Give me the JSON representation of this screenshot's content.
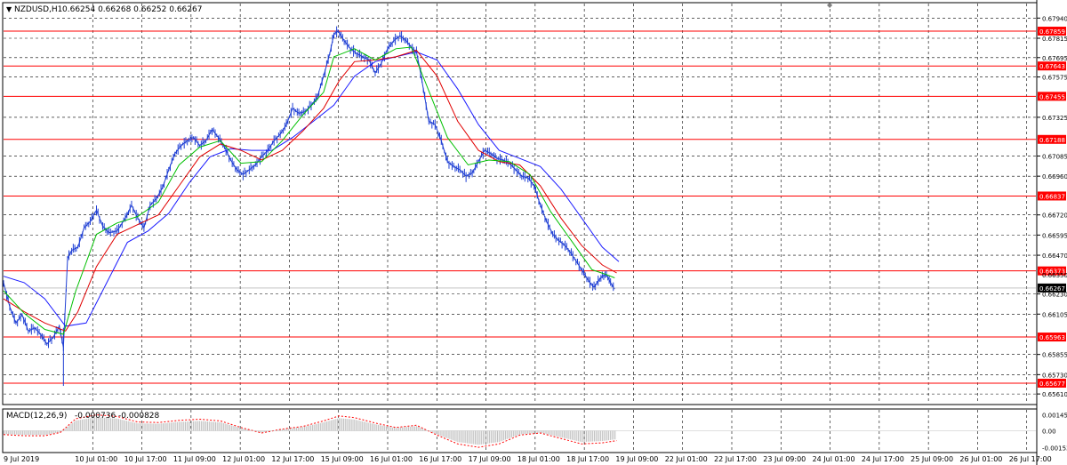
{
  "header": {
    "symbol_tf": "NZDUSD,H1",
    "ohlc": "0.66254 0.66268 0.66252 0.66267"
  },
  "macd_header": {
    "label": "MACD(12,26,9)",
    "values": "-0.000736 -0.000828"
  },
  "colors": {
    "background": "#ffffff",
    "grid": "#000000",
    "candles": "#1f3fd4",
    "ma_fast": "#00c000",
    "ma_mid": "#e00000",
    "ma_slow": "#1a1aff",
    "levels": "#ff0000",
    "macd_hist": "#c0c0c0",
    "macd_signal": "#ff0000"
  },
  "chart_data": [
    {
      "type": "line",
      "title": "NZDUSD,H1",
      "ylim": [
        0.6555,
        0.6803
      ],
      "y_ticks": [
        "0.67940",
        "0.67815",
        "0.67695",
        "0.67575",
        "0.67325",
        "0.67085",
        "0.66960",
        "0.66720",
        "0.66595",
        "0.66470",
        "0.66230",
        "0.66105",
        "0.65855",
        "0.65730",
        "0.65610"
      ],
      "x_labels": [
        "9 Jul 2019",
        "10 Jul 01:00",
        "10 Jul 17:00",
        "11 Jul 09:00",
        "12 Jul 01:00",
        "12 Jul 17:00",
        "15 Jul 09:00",
        "16 Jul 01:00",
        "16 Jul 17:00",
        "17 Jul 09:00",
        "18 Jul 01:00",
        "18 Jul 17:00",
        "19 Jul 09:00",
        "22 Jul 01:00",
        "22 Jul 17:00",
        "23 Jul 09:00",
        "24 Jul 01:00",
        "24 Jul 17:00",
        "25 Jul 09:00",
        "26 Jul 01:00",
        "26 Jul 17:00"
      ],
      "levels": [
        0.67859,
        0.67643,
        0.67455,
        0.67188,
        0.66837,
        0.66373,
        0.65963,
        0.65677
      ],
      "level_labels": [
        "0.67859",
        "0.67643",
        "0.67455",
        "0.67188",
        "0.66837",
        "0.66373",
        "0.65963",
        "0.65677"
      ],
      "current_price": 0.66267,
      "current_price_label": "0.66267",
      "extra_tick_label": "0.66350",
      "price_path": [
        [
          0,
          0.663
        ],
        [
          6,
          0.6615
        ],
        [
          12,
          0.6605
        ],
        [
          18,
          0.661
        ],
        [
          24,
          0.66
        ],
        [
          30,
          0.6602
        ],
        [
          36,
          0.6598
        ],
        [
          42,
          0.6592
        ],
        [
          48,
          0.6596
        ],
        [
          54,
          0.6603
        ],
        [
          58,
          0.659
        ],
        [
          62,
          0.6645
        ],
        [
          66,
          0.665
        ],
        [
          72,
          0.6652
        ],
        [
          78,
          0.6664
        ],
        [
          84,
          0.6668
        ],
        [
          90,
          0.6675
        ],
        [
          96,
          0.6665
        ],
        [
          102,
          0.6661
        ],
        [
          110,
          0.6662
        ],
        [
          118,
          0.667
        ],
        [
          124,
          0.6678
        ],
        [
          130,
          0.667
        ],
        [
          136,
          0.6664
        ],
        [
          142,
          0.6678
        ],
        [
          148,
          0.6682
        ],
        [
          154,
          0.6689
        ],
        [
          160,
          0.67
        ],
        [
          166,
          0.671
        ],
        [
          172,
          0.6715
        ],
        [
          178,
          0.6718
        ],
        [
          184,
          0.672
        ],
        [
          190,
          0.6715
        ],
        [
          196,
          0.6718
        ],
        [
          202,
          0.6725
        ],
        [
          208,
          0.672
        ],
        [
          214,
          0.6714
        ],
        [
          220,
          0.6706
        ],
        [
          226,
          0.67
        ],
        [
          232,
          0.6697
        ],
        [
          238,
          0.67
        ],
        [
          244,
          0.6703
        ],
        [
          250,
          0.6708
        ],
        [
          256,
          0.6712
        ],
        [
          262,
          0.6718
        ],
        [
          268,
          0.6722
        ],
        [
          274,
          0.6728
        ],
        [
          280,
          0.6738
        ],
        [
          286,
          0.6735
        ],
        [
          292,
          0.6736
        ],
        [
          298,
          0.674
        ],
        [
          304,
          0.6745
        ],
        [
          310,
          0.6758
        ],
        [
          316,
          0.6772
        ],
        [
          320,
          0.6784
        ],
        [
          324,
          0.6786
        ],
        [
          330,
          0.678
        ],
        [
          336,
          0.6775
        ],
        [
          342,
          0.6772
        ],
        [
          348,
          0.677
        ],
        [
          354,
          0.6768
        ],
        [
          360,
          0.676
        ],
        [
          366,
          0.6766
        ],
        [
          372,
          0.6775
        ],
        [
          378,
          0.678
        ],
        [
          384,
          0.6783
        ],
        [
          390,
          0.678
        ],
        [
          396,
          0.6775
        ],
        [
          400,
          0.6773
        ],
        [
          404,
          0.676
        ],
        [
          408,
          0.6745
        ],
        [
          412,
          0.673
        ],
        [
          418,
          0.6728
        ],
        [
          424,
          0.6718
        ],
        [
          430,
          0.6705
        ],
        [
          436,
          0.6702
        ],
        [
          442,
          0.67
        ],
        [
          448,
          0.6696
        ],
        [
          454,
          0.6698
        ],
        [
          460,
          0.6705
        ],
        [
          466,
          0.6712
        ],
        [
          472,
          0.671
        ],
        [
          478,
          0.6707
        ],
        [
          484,
          0.6706
        ],
        [
          490,
          0.6704
        ],
        [
          496,
          0.67
        ],
        [
          502,
          0.6696
        ],
        [
          508,
          0.6695
        ],
        [
          514,
          0.669
        ],
        [
          520,
          0.6678
        ],
        [
          526,
          0.6668
        ],
        [
          532,
          0.666
        ],
        [
          538,
          0.6656
        ],
        [
          544,
          0.6653
        ],
        [
          550,
          0.6648
        ],
        [
          556,
          0.6642
        ],
        [
          562,
          0.6636
        ],
        [
          568,
          0.663
        ],
        [
          572,
          0.6627
        ],
        [
          576,
          0.6631
        ],
        [
          580,
          0.6634
        ],
        [
          584,
          0.6635
        ],
        [
          588,
          0.663
        ],
        [
          592,
          0.6626
        ]
      ],
      "ma_fast": [
        [
          0,
          0.6625
        ],
        [
          20,
          0.6611
        ],
        [
          40,
          0.6601
        ],
        [
          58,
          0.6598
        ],
        [
          70,
          0.6625
        ],
        [
          90,
          0.666
        ],
        [
          110,
          0.6667
        ],
        [
          130,
          0.6671
        ],
        [
          150,
          0.668
        ],
        [
          170,
          0.6703
        ],
        [
          190,
          0.6714
        ],
        [
          210,
          0.6718
        ],
        [
          230,
          0.6704
        ],
        [
          250,
          0.6705
        ],
        [
          270,
          0.6718
        ],
        [
          290,
          0.6734
        ],
        [
          310,
          0.6748
        ],
        [
          320,
          0.677
        ],
        [
          340,
          0.6775
        ],
        [
          360,
          0.6768
        ],
        [
          380,
          0.6775
        ],
        [
          395,
          0.6776
        ],
        [
          410,
          0.6752
        ],
        [
          430,
          0.672
        ],
        [
          450,
          0.6703
        ],
        [
          470,
          0.6706
        ],
        [
          490,
          0.6705
        ],
        [
          510,
          0.6697
        ],
        [
          530,
          0.6674
        ],
        [
          550,
          0.6656
        ],
        [
          570,
          0.6638
        ],
        [
          584,
          0.6635
        ],
        [
          592,
          0.6633
        ]
      ],
      "ma_mid": [
        [
          0,
          0.662
        ],
        [
          20,
          0.6612
        ],
        [
          40,
          0.6605
        ],
        [
          60,
          0.66
        ],
        [
          72,
          0.6612
        ],
        [
          90,
          0.664
        ],
        [
          110,
          0.666
        ],
        [
          130,
          0.6666
        ],
        [
          150,
          0.6672
        ],
        [
          170,
          0.669
        ],
        [
          190,
          0.6708
        ],
        [
          210,
          0.6716
        ],
        [
          230,
          0.6712
        ],
        [
          250,
          0.6706
        ],
        [
          270,
          0.6712
        ],
        [
          290,
          0.6724
        ],
        [
          310,
          0.6738
        ],
        [
          325,
          0.6755
        ],
        [
          340,
          0.6767
        ],
        [
          360,
          0.6768
        ],
        [
          380,
          0.677
        ],
        [
          400,
          0.6774
        ],
        [
          420,
          0.6758
        ],
        [
          440,
          0.673
        ],
        [
          460,
          0.6712
        ],
        [
          480,
          0.6705
        ],
        [
          500,
          0.6703
        ],
        [
          520,
          0.669
        ],
        [
          540,
          0.667
        ],
        [
          560,
          0.6653
        ],
        [
          580,
          0.6641
        ],
        [
          594,
          0.6636
        ]
      ],
      "ma_slow": [
        [
          0,
          0.6634
        ],
        [
          20,
          0.663
        ],
        [
          40,
          0.662
        ],
        [
          60,
          0.6603
        ],
        [
          80,
          0.6605
        ],
        [
          100,
          0.663
        ],
        [
          120,
          0.6655
        ],
        [
          140,
          0.6662
        ],
        [
          160,
          0.6673
        ],
        [
          180,
          0.6692
        ],
        [
          200,
          0.6708
        ],
        [
          220,
          0.6713
        ],
        [
          240,
          0.6712
        ],
        [
          260,
          0.6712
        ],
        [
          280,
          0.672
        ],
        [
          300,
          0.673
        ],
        [
          320,
          0.674
        ],
        [
          340,
          0.6758
        ],
        [
          360,
          0.6767
        ],
        [
          380,
          0.677
        ],
        [
          400,
          0.6773
        ],
        [
          420,
          0.6768
        ],
        [
          440,
          0.675
        ],
        [
          460,
          0.6728
        ],
        [
          480,
          0.6712
        ],
        [
          500,
          0.6707
        ],
        [
          520,
          0.6702
        ],
        [
          540,
          0.6688
        ],
        [
          560,
          0.667
        ],
        [
          580,
          0.6652
        ],
        [
          596,
          0.6643
        ]
      ]
    },
    {
      "type": "bar",
      "title": "MACD(12,26,9)",
      "ylim": [
        -0.0019,
        0.0019
      ],
      "y_ticks": [
        "0.001451",
        "0.00",
        "-0.001531"
      ],
      "signal_path": [
        [
          0,
          -0.00035
        ],
        [
          20,
          -0.00045
        ],
        [
          40,
          -0.00045
        ],
        [
          55,
          -0.00015
        ],
        [
          70,
          0.0011
        ],
        [
          90,
          0.00145
        ],
        [
          110,
          0.0013
        ],
        [
          130,
          0.0008
        ],
        [
          150,
          0.00075
        ],
        [
          170,
          0.00095
        ],
        [
          190,
          0.00105
        ],
        [
          210,
          0.0009
        ],
        [
          230,
          0.0003
        ],
        [
          250,
          -0.0002
        ],
        [
          270,
          0.00015
        ],
        [
          290,
          0.0004
        ],
        [
          310,
          0.0009
        ],
        [
          325,
          0.00135
        ],
        [
          340,
          0.0012
        ],
        [
          360,
          0.0007
        ],
        [
          380,
          0.0003
        ],
        [
          400,
          0.0005
        ],
        [
          420,
          -0.0004
        ],
        [
          440,
          -0.0012
        ],
        [
          460,
          -0.0015
        ],
        [
          480,
          -0.0012
        ],
        [
          500,
          -0.0004
        ],
        [
          520,
          -0.0002
        ],
        [
          540,
          -0.0007
        ],
        [
          560,
          -0.0012
        ],
        [
          580,
          -0.0011
        ],
        [
          594,
          -0.0009
        ]
      ]
    }
  ]
}
